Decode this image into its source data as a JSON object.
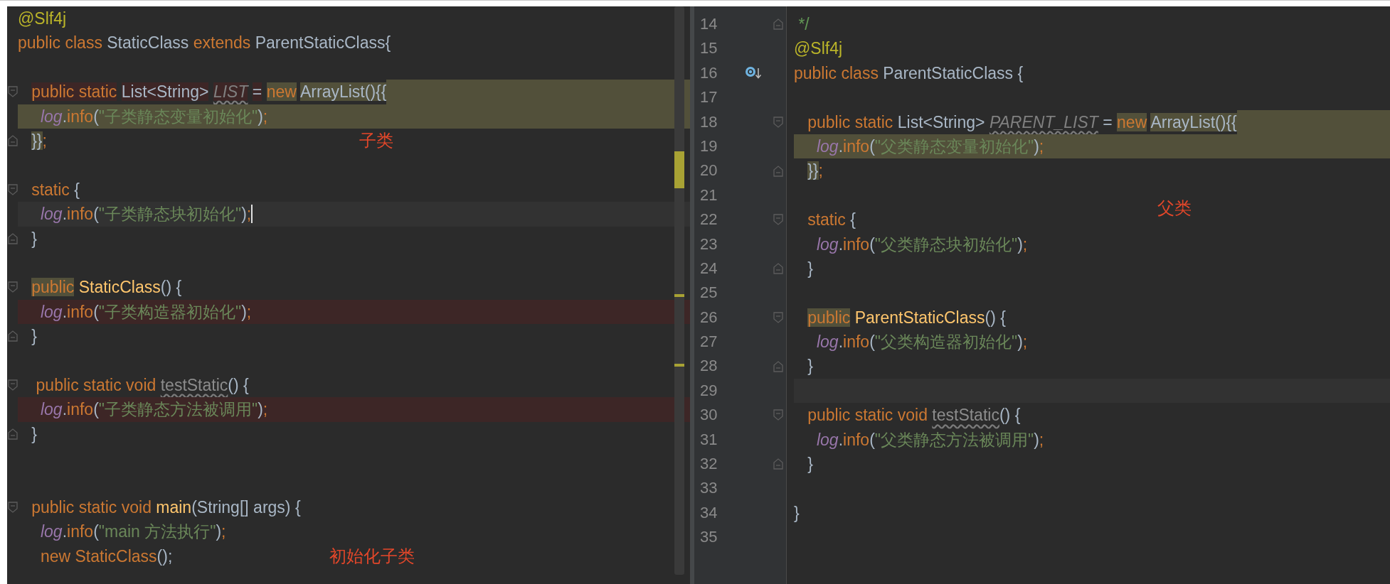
{
  "panes": [
    {
      "kind": "plain",
      "lines": [
        {
          "kind": "code",
          "tokens": [
            {
              "kind": "annotation",
              "text": "@Slf4j"
            }
          ]
        },
        {
          "kind": "code",
          "tokens": [
            {
              "kind": "keyword",
              "text": "public class "
            },
            {
              "kind": "plain",
              "text": "StaticClass "
            },
            {
              "kind": "keyword",
              "text": "extends "
            },
            {
              "kind": "plain",
              "text": "ParentStaticClass{"
            }
          ]
        },
        {
          "kind": "blank"
        },
        {
          "kind": "code",
          "fold_start": true,
          "tail_marked": true,
          "tokens": [
            {
              "kind": "keyword",
              "text": "   public static ",
              "error": true
            },
            {
              "kind": "plain",
              "text": "List<String> ",
              "error": true
            },
            {
              "kind": "field",
              "text": "LIST",
              "error": true,
              "warning": true
            },
            {
              "kind": "plain",
              "text": " = ",
              "error": true
            },
            {
              "kind": "keyword",
              "text": "new ",
              "marked": true
            },
            {
              "kind": "plain",
              "text": "ArrayList(){{",
              "marked": true
            }
          ]
        },
        {
          "kind": "code",
          "highlighted": true,
          "tokens": [
            {
              "kind": "log",
              "text": "     log"
            },
            {
              "kind": "plain",
              "text": "."
            },
            {
              "kind": "call",
              "text": "info"
            },
            {
              "kind": "plain",
              "text": "("
            },
            {
              "kind": "string",
              "text": "\"子类静态变量初始化\""
            },
            {
              "kind": "plain",
              "text": ")"
            },
            {
              "kind": "keyword",
              "text": ";"
            }
          ]
        },
        {
          "kind": "code",
          "fold_end": true,
          "note": "子类",
          "tokens": [
            {
              "kind": "plain",
              "text": "   }}",
              "marked": true
            },
            {
              "kind": "keyword",
              "text": ";"
            }
          ]
        },
        {
          "kind": "blank"
        },
        {
          "kind": "code",
          "fold_start": true,
          "tokens": [
            {
              "kind": "keyword",
              "text": "   static "
            },
            {
              "kind": "plain",
              "text": "{"
            }
          ]
        },
        {
          "kind": "code",
          "current": true,
          "caret": true,
          "tokens": [
            {
              "kind": "log",
              "text": "     log"
            },
            {
              "kind": "plain",
              "text": "."
            },
            {
              "kind": "call",
              "text": "info"
            },
            {
              "kind": "plain",
              "text": "("
            },
            {
              "kind": "string",
              "text": "\"子类静态块初始化\""
            },
            {
              "kind": "plain",
              "text": ")"
            },
            {
              "kind": "keyword",
              "text": ";"
            }
          ]
        },
        {
          "kind": "code",
          "fold_end": true,
          "tokens": [
            {
              "kind": "plain",
              "text": "   }"
            }
          ]
        },
        {
          "kind": "blank"
        },
        {
          "kind": "code",
          "fold_start": true,
          "tokens": [
            {
              "kind": "keyword",
              "text": "   public ",
              "marked": true
            },
            {
              "kind": "decl",
              "text": "StaticClass"
            },
            {
              "kind": "plain",
              "text": "() {"
            }
          ]
        },
        {
          "kind": "code",
          "error": true,
          "tokens": [
            {
              "kind": "log",
              "text": "     log"
            },
            {
              "kind": "plain",
              "text": "."
            },
            {
              "kind": "call",
              "text": "info"
            },
            {
              "kind": "plain",
              "text": "("
            },
            {
              "kind": "string",
              "text": "\"子类构造器初始化\""
            },
            {
              "kind": "plain",
              "text": ")"
            },
            {
              "kind": "keyword",
              "text": ";"
            }
          ]
        },
        {
          "kind": "code",
          "fold_end": true,
          "tokens": [
            {
              "kind": "plain",
              "text": "   }"
            }
          ]
        },
        {
          "kind": "blank"
        },
        {
          "kind": "code",
          "fold_start": true,
          "tokens": [
            {
              "kind": "keyword",
              "text": "    public static void "
            },
            {
              "kind": "unused",
              "text": "testStatic",
              "warning": true
            },
            {
              "kind": "plain",
              "text": "() {"
            }
          ]
        },
        {
          "kind": "code",
          "error": true,
          "tokens": [
            {
              "kind": "log",
              "text": "     log"
            },
            {
              "kind": "plain",
              "text": "."
            },
            {
              "kind": "call",
              "text": "info"
            },
            {
              "kind": "plain",
              "text": "("
            },
            {
              "kind": "string",
              "text": "\"子类静态方法被调用\""
            },
            {
              "kind": "plain",
              "text": ")"
            },
            {
              "kind": "keyword",
              "text": ";"
            }
          ]
        },
        {
          "kind": "code",
          "fold_end": true,
          "tokens": [
            {
              "kind": "plain",
              "text": "   }"
            }
          ]
        },
        {
          "kind": "blank"
        },
        {
          "kind": "blank"
        },
        {
          "kind": "code",
          "fold_start": true,
          "tokens": [
            {
              "kind": "keyword",
              "text": "   public static void "
            },
            {
              "kind": "decl",
              "text": "main"
            },
            {
              "kind": "plain",
              "text": "(String[] args) {"
            }
          ]
        },
        {
          "kind": "code",
          "tokens": [
            {
              "kind": "log",
              "text": "     log"
            },
            {
              "kind": "plain",
              "text": "."
            },
            {
              "kind": "call",
              "text": "info"
            },
            {
              "kind": "plain",
              "text": "("
            },
            {
              "kind": "string",
              "text": "\"main 方法执行\""
            },
            {
              "kind": "plain",
              "text": ")"
            },
            {
              "kind": "keyword",
              "text": ";"
            }
          ]
        },
        {
          "kind": "code",
          "note": "初始化子类",
          "tokens": [
            {
              "kind": "keyword",
              "text": "     new StaticClass"
            },
            {
              "kind": "plain",
              "text": "();"
            }
          ]
        }
      ]
    },
    {
      "kind": "numbered",
      "lines": [
        {
          "kind": "code",
          "number": "14",
          "fold_end": true,
          "tokens": [
            {
              "kind": "comment",
              "text": " */"
            }
          ]
        },
        {
          "kind": "code",
          "number": "15",
          "tokens": [
            {
              "kind": "annotation",
              "text": "@Slf4j"
            }
          ]
        },
        {
          "kind": "code",
          "number": "16",
          "implemented": true,
          "tokens": [
            {
              "kind": "keyword",
              "text": "public class "
            },
            {
              "kind": "plain",
              "text": "ParentStaticClass {"
            }
          ]
        },
        {
          "kind": "blank",
          "number": "17"
        },
        {
          "kind": "code",
          "number": "18",
          "fold_start": true,
          "tail_marked": true,
          "tokens": [
            {
              "kind": "keyword",
              "text": "   public static "
            },
            {
              "kind": "plain",
              "text": "List<String> "
            },
            {
              "kind": "field",
              "text": "PARENT_LIST",
              "warning": true
            },
            {
              "kind": "plain",
              "text": " = "
            },
            {
              "kind": "keyword",
              "text": "new ",
              "marked": true
            },
            {
              "kind": "plain",
              "text": "ArrayList(){{",
              "marked": true
            }
          ]
        },
        {
          "kind": "code",
          "number": "19",
          "highlighted": true,
          "tokens": [
            {
              "kind": "log",
              "text": "     log"
            },
            {
              "kind": "plain",
              "text": "."
            },
            {
              "kind": "call",
              "text": "info"
            },
            {
              "kind": "plain",
              "text": "("
            },
            {
              "kind": "string",
              "text": "\"父类静态变量初始化\""
            },
            {
              "kind": "plain",
              "text": ")"
            },
            {
              "kind": "keyword",
              "text": ";"
            }
          ]
        },
        {
          "kind": "code",
          "number": "20",
          "fold_end": true,
          "tokens": [
            {
              "kind": "plain",
              "text": "   }}",
              "marked": true
            },
            {
              "kind": "keyword",
              "text": ";"
            }
          ]
        },
        {
          "kind": "blank",
          "number": "21",
          "note": "父类"
        },
        {
          "kind": "code",
          "number": "22",
          "fold_start": true,
          "tokens": [
            {
              "kind": "keyword",
              "text": "   static "
            },
            {
              "kind": "plain",
              "text": "{"
            }
          ]
        },
        {
          "kind": "code",
          "number": "23",
          "tokens": [
            {
              "kind": "log",
              "text": "     log"
            },
            {
              "kind": "plain",
              "text": "."
            },
            {
              "kind": "call",
              "text": "info"
            },
            {
              "kind": "plain",
              "text": "("
            },
            {
              "kind": "string",
              "text": "\"父类静态块初始化\""
            },
            {
              "kind": "plain",
              "text": ")"
            },
            {
              "kind": "keyword",
              "text": ";"
            }
          ]
        },
        {
          "kind": "code",
          "number": "24",
          "fold_end": true,
          "tokens": [
            {
              "kind": "plain",
              "text": "   }"
            }
          ]
        },
        {
          "kind": "blank",
          "number": "25"
        },
        {
          "kind": "code",
          "number": "26",
          "fold_start": true,
          "tokens": [
            {
              "kind": "keyword",
              "text": "   public ",
              "marked": true
            },
            {
              "kind": "decl",
              "text": "ParentStaticClass"
            },
            {
              "kind": "plain",
              "text": "() {"
            }
          ]
        },
        {
          "kind": "code",
          "number": "27",
          "tokens": [
            {
              "kind": "log",
              "text": "     log"
            },
            {
              "kind": "plain",
              "text": "."
            },
            {
              "kind": "call",
              "text": "info"
            },
            {
              "kind": "plain",
              "text": "("
            },
            {
              "kind": "string",
              "text": "\"父类构造器初始化\""
            },
            {
              "kind": "plain",
              "text": ")"
            },
            {
              "kind": "keyword",
              "text": ";"
            }
          ]
        },
        {
          "kind": "code",
          "number": "28",
          "fold_end": true,
          "tokens": [
            {
              "kind": "plain",
              "text": "   }"
            }
          ]
        },
        {
          "kind": "blank",
          "number": "29",
          "current": true
        },
        {
          "kind": "code",
          "number": "30",
          "fold_start": true,
          "tokens": [
            {
              "kind": "keyword",
              "text": "   public static void "
            },
            {
              "kind": "unused",
              "text": "testStatic",
              "warning": true
            },
            {
              "kind": "plain",
              "text": "() {"
            }
          ]
        },
        {
          "kind": "code",
          "number": "31",
          "tokens": [
            {
              "kind": "log",
              "text": "     log"
            },
            {
              "kind": "plain",
              "text": "."
            },
            {
              "kind": "call",
              "text": "info"
            },
            {
              "kind": "plain",
              "text": "("
            },
            {
              "kind": "string",
              "text": "\"父类静态方法被调用\""
            },
            {
              "kind": "plain",
              "text": ")"
            },
            {
              "kind": "keyword",
              "text": ";"
            }
          ]
        },
        {
          "kind": "code",
          "number": "32",
          "fold_end": true,
          "tokens": [
            {
              "kind": "plain",
              "text": "   }"
            }
          ]
        },
        {
          "kind": "blank",
          "number": "33"
        },
        {
          "kind": "code",
          "number": "34",
          "tokens": [
            {
              "kind": "plain",
              "text": "}"
            }
          ]
        },
        {
          "kind": "blank",
          "number": "35"
        }
      ]
    }
  ]
}
